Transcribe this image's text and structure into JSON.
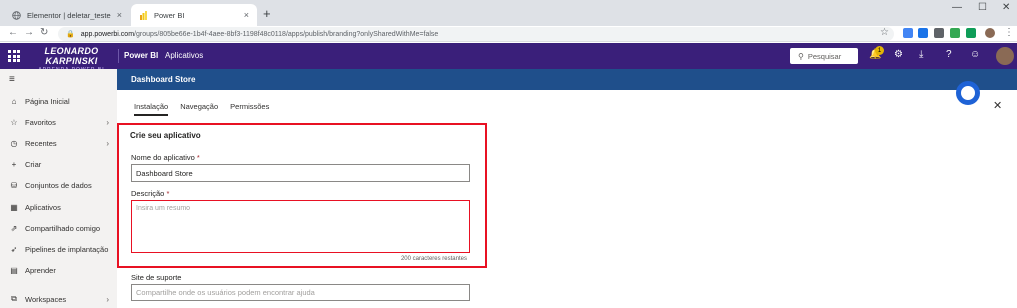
{
  "browser": {
    "tabs": [
      {
        "title": "Elementor | deletar_teste",
        "close": "×"
      },
      {
        "title": "Power BI",
        "close": "×"
      }
    ],
    "new_tab": "+",
    "window_controls": [
      "—",
      "☐",
      "✕"
    ],
    "address": {
      "domain": "app.powerbi.com",
      "path": "/groups/805be66e-1b4f-4aee-8bf3-1198f48c0118/apps/publish/branding?onlySharedWithMe=false"
    },
    "nav": [
      "←",
      "→",
      "↻"
    ]
  },
  "header": {
    "brand_line1": "LEONARDO KARPINSKI",
    "brand_line2": "APRENDA POWER BI",
    "product": "Power BI",
    "breadcrumb": "Aplicativos",
    "search_placeholder": "Pesquisar",
    "notification_count": "1"
  },
  "sidebar": {
    "items": [
      {
        "label": "Página Inicial",
        "icon": "home-icon",
        "chevron": false
      },
      {
        "label": "Favoritos",
        "icon": "star-icon",
        "chevron": true
      },
      {
        "label": "Recentes",
        "icon": "clock-icon",
        "chevron": true
      },
      {
        "label": "Criar",
        "icon": "plus-icon",
        "chevron": false
      },
      {
        "label": "Conjuntos de dados",
        "icon": "database-icon",
        "chevron": false
      },
      {
        "label": "Aplicativos",
        "icon": "apps-icon",
        "chevron": false
      },
      {
        "label": "Compartilhado comigo",
        "icon": "share-icon",
        "chevron": false
      },
      {
        "label": "Pipelines de implantação",
        "icon": "rocket-icon",
        "chevron": false
      },
      {
        "label": "Aprender",
        "icon": "book-icon",
        "chevron": false
      },
      {
        "label": "Workspaces",
        "icon": "workspaces-icon",
        "chevron": true
      }
    ]
  },
  "main": {
    "title": "Dashboard Store",
    "tabs": [
      {
        "label": "Instalação",
        "active": true
      },
      {
        "label": "Navegação",
        "active": false
      },
      {
        "label": "Permissões",
        "active": false
      }
    ],
    "section_title": "Crie seu aplicativo",
    "app_name_label": "Nome do aplicativo",
    "app_name_value": "Dashboard Store",
    "description_label": "Descrição",
    "description_placeholder": "Insira um resumo",
    "description_counter": "200 caracteres restantes",
    "support_label": "Site de suporte",
    "support_placeholder": "Compartilhe onde os usuários podem encontrar ajuda",
    "required_mark": "*"
  },
  "colors": {
    "header_purple": "#3a1f7a",
    "title_bar_blue": "#1f4f8b",
    "highlight_red": "#e81123",
    "cursor_blue": "#1e62d6"
  }
}
